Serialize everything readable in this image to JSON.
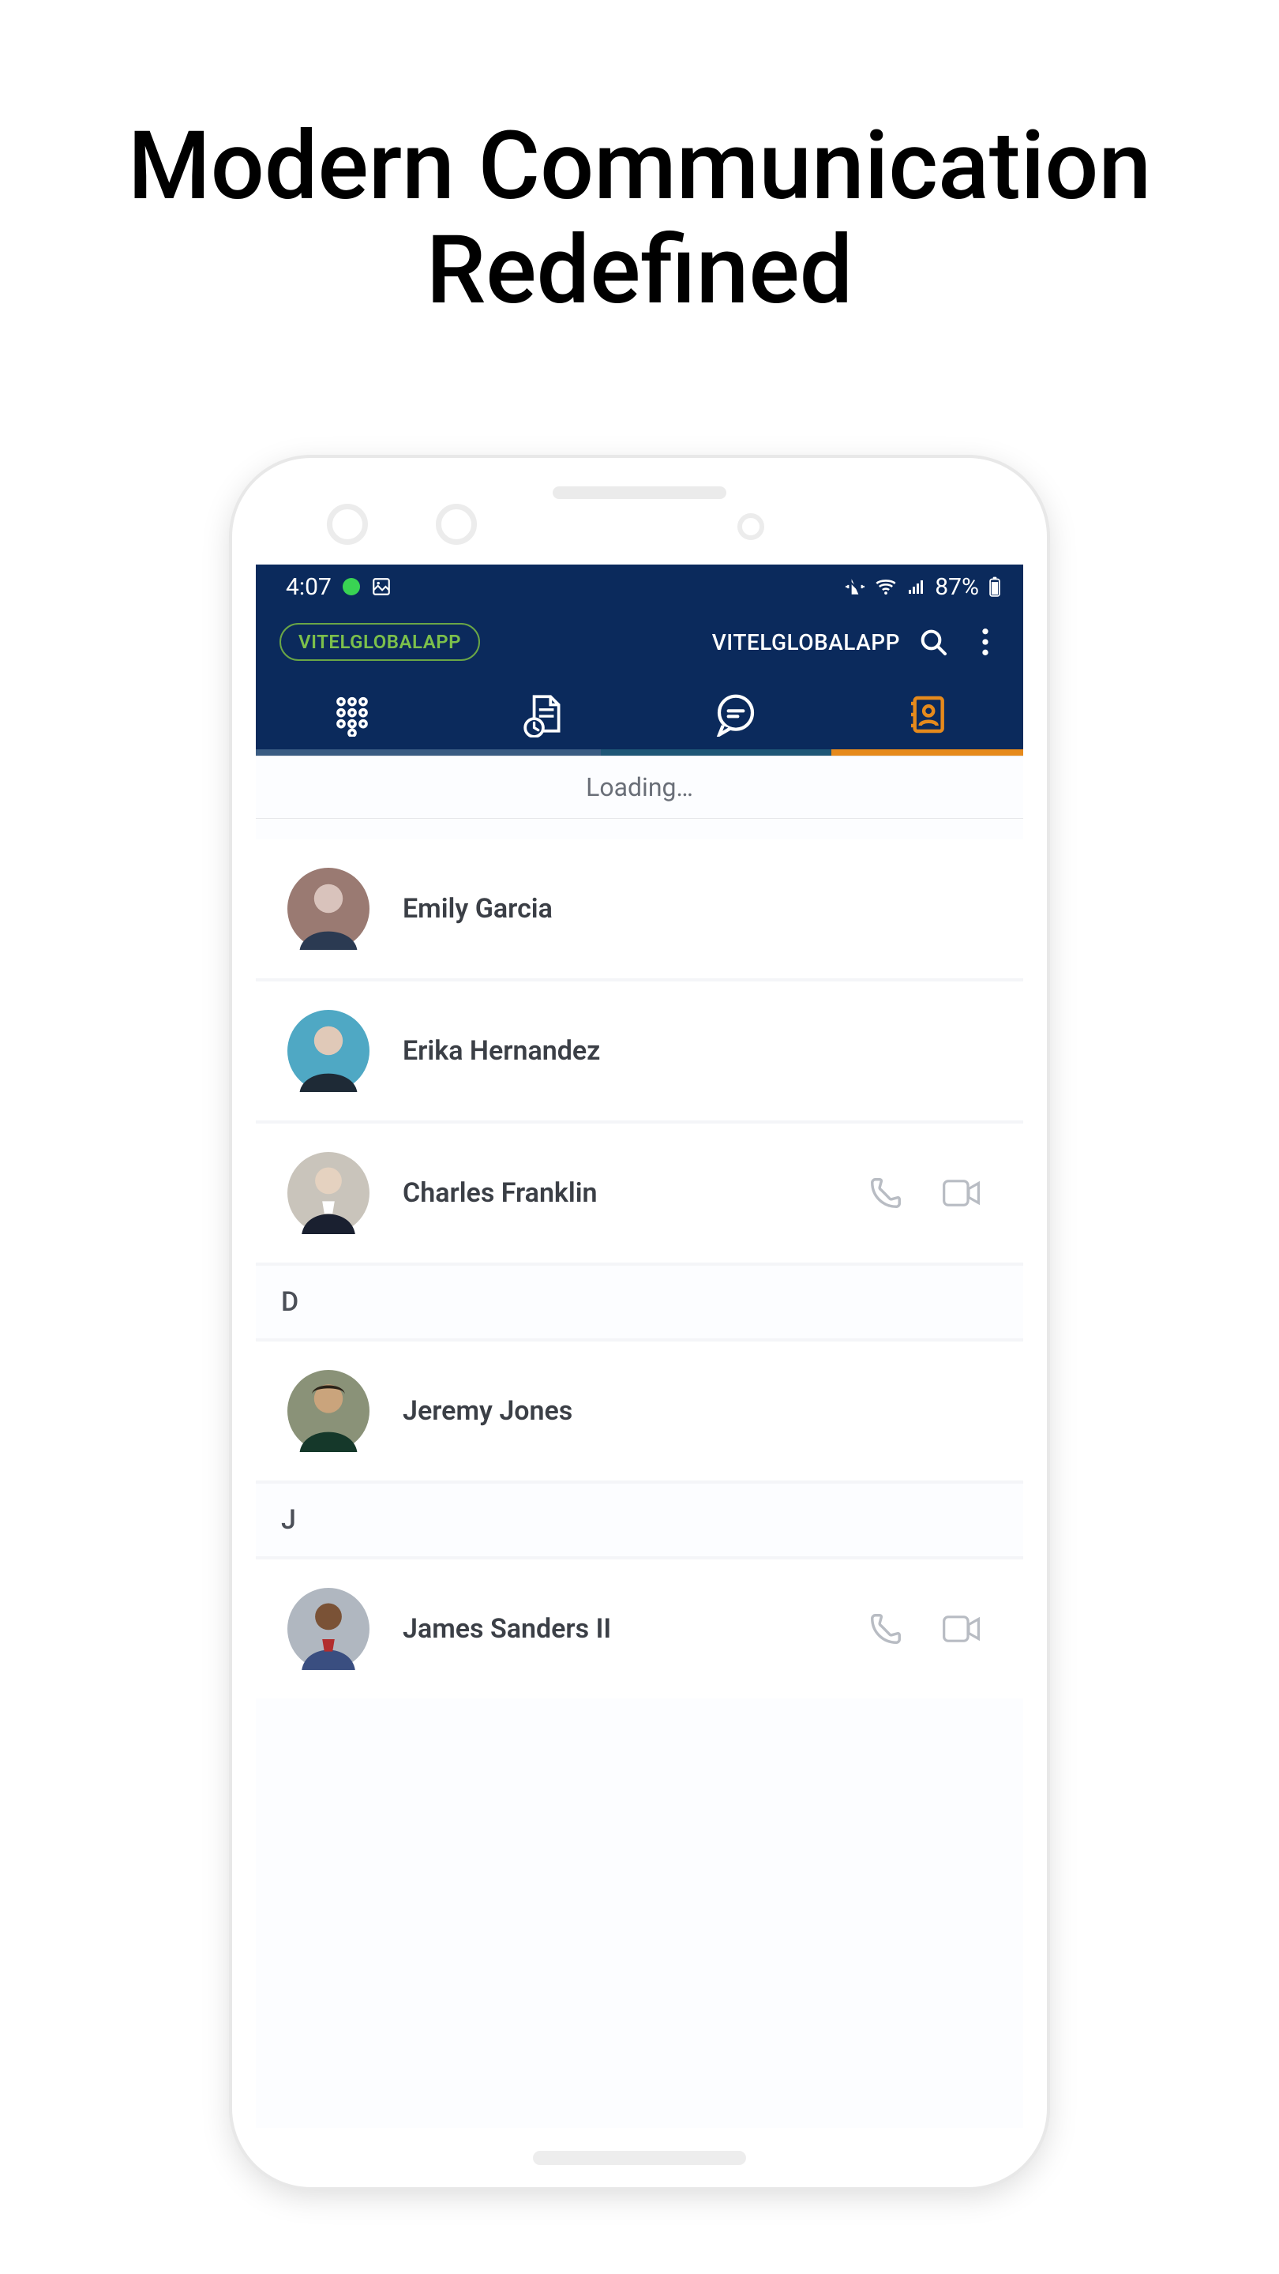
{
  "marketing": {
    "line1": "Modern Communication",
    "line2": "Redefined"
  },
  "status_bar": {
    "time": "4:07",
    "battery_text": "87%"
  },
  "header": {
    "brand_chip": "VITELGLOBALAPP",
    "title": "VITELGLOBALAPP"
  },
  "loading_text": "Loading…",
  "section_headers": {
    "D": "D",
    "J": "J"
  },
  "contacts": [
    {
      "name": "Emily Garcia",
      "avatar_bg": "#9a7a72",
      "has_actions": false
    },
    {
      "name": "Erika Hernandez",
      "avatar_bg": "#3f8fb0",
      "has_actions": false
    },
    {
      "name": "Charles Franklin",
      "avatar_bg": "#2e3a4a",
      "has_actions": true
    },
    {
      "name": "Jeremy Jones",
      "avatar_bg": "#1d3a2a",
      "has_actions": false
    },
    {
      "name": "James Sanders II",
      "avatar_bg": "#3a4e80",
      "has_actions": true
    }
  ]
}
